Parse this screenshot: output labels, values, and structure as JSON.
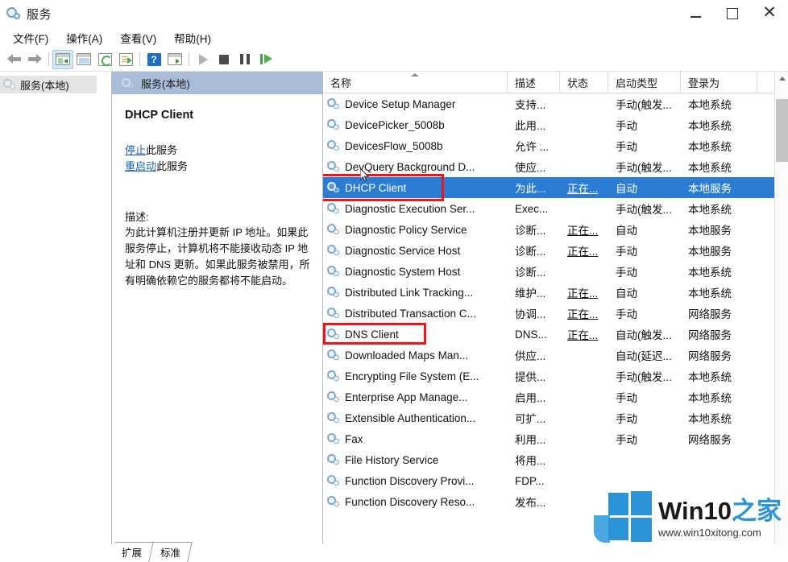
{
  "window": {
    "title": "服务",
    "icon": "services-gear-icon",
    "controls": {
      "minimize": "–",
      "maximize": "□",
      "close": "✕"
    }
  },
  "menubar": {
    "items": [
      {
        "label": "文件(F)",
        "name": "menu-file"
      },
      {
        "label": "操作(A)",
        "name": "menu-action"
      },
      {
        "label": "查看(V)",
        "name": "menu-view"
      },
      {
        "label": "帮助(H)",
        "name": "menu-help"
      }
    ]
  },
  "toolbar": {
    "buttons": [
      {
        "name": "back-arrow-icon",
        "label": "后退"
      },
      {
        "name": "forward-arrow-icon",
        "label": "前进"
      },
      {
        "name": "show-hide-tree-icon",
        "label": "显示/隐藏控制台树"
      },
      {
        "name": "properties-icon",
        "label": "属性"
      },
      {
        "name": "refresh-icon",
        "label": "刷新"
      },
      {
        "name": "export-list-icon",
        "label": "导出列表"
      },
      {
        "name": "help-icon",
        "label": "帮助"
      },
      {
        "name": "show-action-pane-icon",
        "label": "显示操作窗格"
      },
      {
        "name": "start-service-icon",
        "label": "启动服务"
      },
      {
        "name": "stop-service-icon",
        "label": "停止服务"
      },
      {
        "name": "pause-service-icon",
        "label": "暂停服务"
      },
      {
        "name": "restart-service-icon",
        "label": "重启动服务"
      }
    ]
  },
  "tree": {
    "nodes": [
      {
        "label": "服务(本地)",
        "selected": true
      }
    ]
  },
  "detail": {
    "header": "服务(本地)",
    "service_name": "DHCP Client",
    "links": [
      {
        "link_text": "停止",
        "suffix": "此服务"
      },
      {
        "link_text": "重启动",
        "suffix": "此服务"
      }
    ],
    "description_label": "描述:",
    "description": "为此计算机注册并更新 IP 地址。如果此服务停止，计算机将不能接收动态 IP 地址和 DNS 更新。如果此服务被禁用，所有明确依赖它的服务都将不能启动。"
  },
  "list": {
    "columns": [
      {
        "label": "名称",
        "sorted": "asc"
      },
      {
        "label": "描述"
      },
      {
        "label": "状态"
      },
      {
        "label": "启动类型"
      },
      {
        "label": "登录为"
      }
    ],
    "rows": [
      {
        "name": "Device Setup Manager",
        "desc": "支持...",
        "status": "",
        "startup": "手动(触发...",
        "logon": "本地系统"
      },
      {
        "name": "DevicePicker_5008b",
        "desc": "此用...",
        "status": "",
        "startup": "手动",
        "logon": "本地系统"
      },
      {
        "name": "DevicesFlow_5008b",
        "desc": "允许 ...",
        "status": "",
        "startup": "手动",
        "logon": "本地系统"
      },
      {
        "name": "DevQuery Background D...",
        "desc": "使应...",
        "status": "",
        "startup": "手动(触发...",
        "logon": "本地系统"
      },
      {
        "name": "DHCP Client",
        "desc": "为此...",
        "status": "正在...",
        "startup": "自动",
        "logon": "本地服务",
        "selected": true,
        "annotated": true
      },
      {
        "name": "Diagnostic Execution Ser...",
        "desc": "Exec...",
        "status": "",
        "startup": "手动(触发...",
        "logon": "本地系统"
      },
      {
        "name": "Diagnostic Policy Service",
        "desc": "诊断...",
        "status": "正在...",
        "startup": "自动",
        "logon": "本地服务"
      },
      {
        "name": "Diagnostic Service Host",
        "desc": "诊断...",
        "status": "正在...",
        "startup": "手动",
        "logon": "本地服务"
      },
      {
        "name": "Diagnostic System Host",
        "desc": "诊断...",
        "status": "",
        "startup": "手动",
        "logon": "本地系统"
      },
      {
        "name": "Distributed Link Tracking...",
        "desc": "维护...",
        "status": "正在...",
        "startup": "自动",
        "logon": "本地系统"
      },
      {
        "name": "Distributed Transaction C...",
        "desc": "协调...",
        "status": "正在...",
        "startup": "手动",
        "logon": "网络服务"
      },
      {
        "name": "DNS Client",
        "desc": "DNS...",
        "status": "正在...",
        "startup": "自动(触发...",
        "logon": "网络服务",
        "annotated": true
      },
      {
        "name": "Downloaded Maps Man...",
        "desc": "供应...",
        "status": "",
        "startup": "自动(延迟...",
        "logon": "网络服务"
      },
      {
        "name": "Encrypting File System (E...",
        "desc": "提供...",
        "status": "",
        "startup": "手动(触发...",
        "logon": "本地系统"
      },
      {
        "name": "Enterprise App Manage...",
        "desc": "启用...",
        "status": "",
        "startup": "手动",
        "logon": "本地系统"
      },
      {
        "name": "Extensible Authentication...",
        "desc": "可扩...",
        "status": "",
        "startup": "手动",
        "logon": "本地系统"
      },
      {
        "name": "Fax",
        "desc": "利用...",
        "status": "",
        "startup": "手动",
        "logon": "网络服务"
      },
      {
        "name": "File History Service",
        "desc": "将用...",
        "status": "",
        "startup": "",
        "logon": ""
      },
      {
        "name": "Function Discovery Provi...",
        "desc": "FDP...",
        "status": "",
        "startup": "",
        "logon": ""
      },
      {
        "name": "Function Discovery Reso...",
        "desc": "发布...",
        "status": "",
        "startup": "",
        "logon": ""
      }
    ]
  },
  "bottom_tabs": [
    {
      "label": "扩展",
      "active": false
    },
    {
      "label": "标准",
      "active": true
    }
  ],
  "watermark": {
    "brand_latin": "Win10",
    "brand_cn": "之家",
    "url": "www.win10xitong.com"
  },
  "colors": {
    "selection_blue": "#2b7cd3",
    "header_bar": "#a9bcd8",
    "annotation_red": "#f01414",
    "link_blue": "#1a60b8",
    "watermark_blue": "#2b94d9"
  }
}
